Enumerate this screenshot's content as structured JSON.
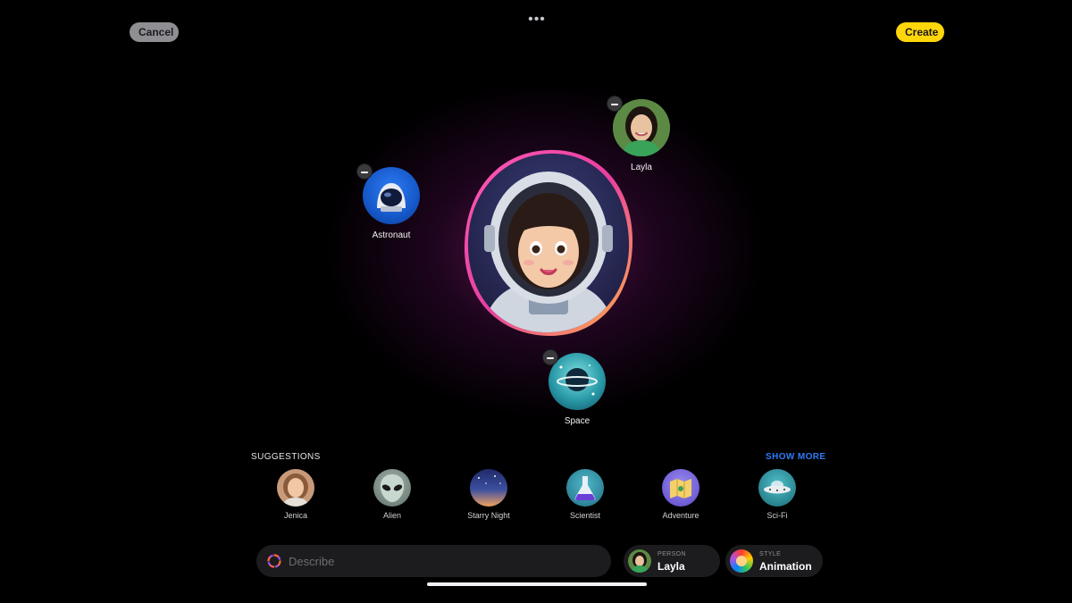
{
  "header": {
    "cancel_label": "Cancel",
    "create_label": "Create",
    "more_label": "•••"
  },
  "canvas": {
    "concepts": [
      {
        "label": "Astronaut",
        "icon": "astronaut-helmet-icon"
      },
      {
        "label": "Layla",
        "icon": "person-photo"
      },
      {
        "label": "Space",
        "icon": "planet-icon"
      }
    ],
    "preview_icon": "astronaut-girl-avatar"
  },
  "suggestions": {
    "title": "SUGGESTIONS",
    "show_more_label": "SHOW MORE",
    "items": [
      {
        "label": "Jenica",
        "icon": "person-photo"
      },
      {
        "label": "Alien",
        "icon": "alien-icon"
      },
      {
        "label": "Starry Night",
        "icon": "night-sky-icon"
      },
      {
        "label": "Scientist",
        "icon": "flask-icon"
      },
      {
        "label": "Adventure",
        "icon": "map-icon"
      },
      {
        "label": "Sci-Fi",
        "icon": "ufo-icon"
      }
    ]
  },
  "bottom_bar": {
    "describe_placeholder": "Describe",
    "person": {
      "caption": "PERSON",
      "value": "Layla"
    },
    "style": {
      "caption": "STYLE",
      "value": "Animation"
    }
  },
  "colors": {
    "create_accent": "#ffd60a",
    "show_more_accent": "#2f7cf6",
    "glow": "#c828a0"
  }
}
